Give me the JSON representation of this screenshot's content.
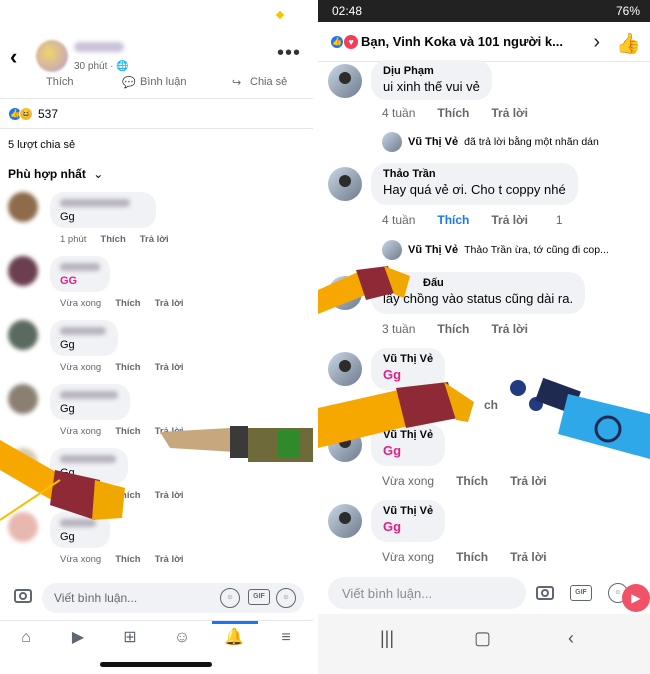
{
  "left": {
    "header": {
      "time": "30 phút · 🌐",
      "more": "•••"
    },
    "actions": {
      "like": "Thích",
      "comment": "Bình luận",
      "share": "Chia sẻ"
    },
    "reactions": {
      "count": "537"
    },
    "shares": "5 lượt chia sẻ",
    "sort": "Phù hợp nhất",
    "comments": [
      {
        "text": "Gg",
        "time": "1 phút",
        "like": "Thích",
        "reply": "Trả lời",
        "pink": false
      },
      {
        "text": "GG",
        "time": "Vừa xong",
        "like": "Thích",
        "reply": "Trả lời",
        "pink": true
      },
      {
        "text": "Gg",
        "time": "Vừa xong",
        "like": "Thích",
        "reply": "Trả lời",
        "pink": false
      },
      {
        "text": "Gg",
        "time": "Vừa xong",
        "like": "Thích",
        "reply": "Trả lời",
        "pink": false
      },
      {
        "text": "Gg",
        "time": "Vừa xong",
        "like": "Thích",
        "reply": "Trả lời",
        "pink": false
      },
      {
        "text": "Gg",
        "time": "Vừa xong",
        "like": "Thích",
        "reply": "Trả lời",
        "pink": false
      }
    ],
    "input_placeholder": "Viết bình luận...",
    "gif": "GIF"
  },
  "right": {
    "status": {
      "time": "02:48",
      "battery": "76%"
    },
    "title": "Bạn, Vinh Koka và 101 người k...",
    "comments": [
      {
        "name": "Dịu Phạm",
        "text": "ui xinh thế vui vẻ",
        "time": "4 tuần",
        "like": "Thích",
        "reply": "Trả lời"
      },
      {
        "name": "Thảo Trần",
        "text": "Hay quá vẻ ơi. Cho t coppy nhé",
        "time": "4 tuần",
        "like": "Thích",
        "reply": "Trả lời",
        "count": "1"
      },
      {
        "name": "Đấu",
        "text": "lấy chồng vào status cũng dài ra.",
        "time": "3 tuần",
        "like": "Thích",
        "reply": "Trả lời"
      },
      {
        "name": "Vũ Thị Vẻ",
        "text": "Gg",
        "time": "",
        "like": "",
        "reply": ""
      },
      {
        "name": "Vũ Thị Vẻ",
        "text": "Gg",
        "time": "Vừa xong",
        "like": "Thích",
        "reply": "Trả lời"
      },
      {
        "name": "Vũ Thị Vẻ",
        "text": "Gg",
        "time": "Vừa xong",
        "like": "Thích",
        "reply": "Trả lời"
      }
    ],
    "replies": [
      {
        "name": "Vũ Thị Vẻ",
        "text": "đã trả lời bằng một nhãn dán"
      },
      {
        "name": "Vũ Thị Vẻ",
        "text": "Thảo Trần ừa, tớ cũng đi cop..."
      }
    ],
    "r_like_partial": "ch",
    "input_placeholder": "Viết bình luận...",
    "gif": "GIF"
  },
  "colors": {
    "accent": "#1877f2",
    "pink": "#e0218a",
    "bubble": "#f0f2f5"
  }
}
